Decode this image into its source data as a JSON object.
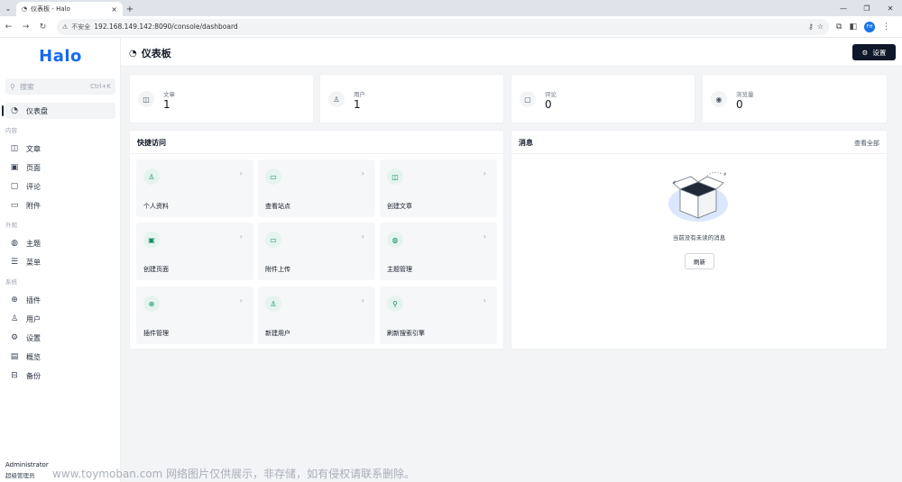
{
  "browser": {
    "tab_title": "仪表板 - Halo",
    "tab_close": "×",
    "new_tab": "+",
    "security_label": "不安全",
    "url": "192.168.149.142:8090/console/dashboard",
    "profile": "FH"
  },
  "sidebar": {
    "logo": "Halo",
    "search_placeholder": "搜索",
    "search_shortcut": "Ctrl+K",
    "dashboard": "仪表盘",
    "groups": {
      "content": "内容",
      "appearance": "外观",
      "system": "系统"
    },
    "items": {
      "posts": "文章",
      "pages": "页面",
      "comments": "评论",
      "attachments": "附件",
      "themes": "主题",
      "menus": "菜单",
      "plugins": "插件",
      "users": "用户",
      "settings": "设置",
      "overview": "概览",
      "backup": "备份"
    },
    "user": {
      "name": "Administrator",
      "role": "超级管理员"
    }
  },
  "header": {
    "title": "仪表板",
    "settings_label": "设置"
  },
  "stats": [
    {
      "label": "文章",
      "value": "1"
    },
    {
      "label": "用户",
      "value": "1"
    },
    {
      "label": "评论",
      "value": "0"
    },
    {
      "label": "浏览量",
      "value": "0"
    }
  ],
  "quick_access": {
    "title": "快捷访问",
    "items": [
      {
        "label": "个人资料",
        "icon": "user-icon"
      },
      {
        "label": "查看站点",
        "icon": "window-icon"
      },
      {
        "label": "创建文章",
        "icon": "book-icon"
      },
      {
        "label": "创建页面",
        "icon": "page-icon"
      },
      {
        "label": "附件上传",
        "icon": "folder-icon"
      },
      {
        "label": "主题管理",
        "icon": "palette-icon"
      },
      {
        "label": "插件管理",
        "icon": "plug-icon"
      },
      {
        "label": "新建用户",
        "icon": "user-add-icon"
      },
      {
        "label": "刷新搜索引擎",
        "icon": "search-icon"
      }
    ]
  },
  "notifications": {
    "title": "消息",
    "view_all": "查看全部",
    "empty_text": "当前没有未读的消息",
    "refresh": "刷新"
  },
  "watermark": "www.toymoban.com 网络图片仅供展示，非存储，如有侵权请联系删除。"
}
